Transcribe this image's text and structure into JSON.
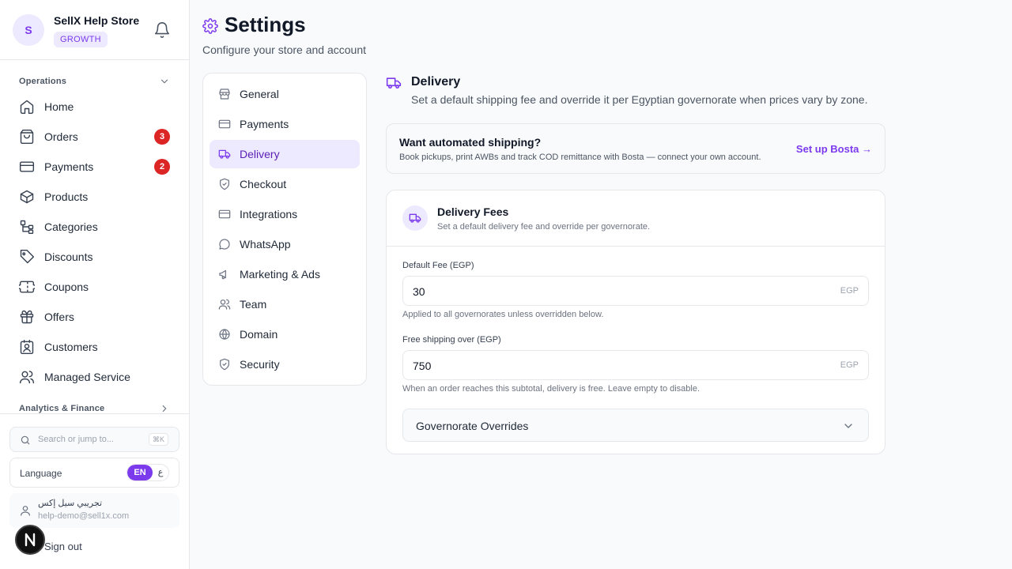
{
  "store": {
    "avatar_letter": "S",
    "name": "SellX Help Store",
    "plan": "GROWTH"
  },
  "sidebar": {
    "operations_title": "Operations",
    "items": [
      {
        "label": "Home",
        "icon": "home-icon"
      },
      {
        "label": "Orders",
        "icon": "shopping-bag-icon",
        "badge": "3"
      },
      {
        "label": "Payments",
        "icon": "credit-card-icon",
        "badge": "2"
      },
      {
        "label": "Products",
        "icon": "box-icon"
      },
      {
        "label": "Categories",
        "icon": "hierarchy-icon"
      },
      {
        "label": "Discounts",
        "icon": "tag-icon"
      },
      {
        "label": "Coupons",
        "icon": "ticket-icon"
      },
      {
        "label": "Offers",
        "icon": "gift-icon"
      },
      {
        "label": "Customers",
        "icon": "contact-icon"
      },
      {
        "label": "Managed Service",
        "icon": "users-icon"
      }
    ],
    "analytics_title": "Analytics & Finance",
    "search_placeholder": "Search or jump to...",
    "search_shortcut": "⌘K",
    "language_label": "Language",
    "lang_en": "EN",
    "lang_ar": "ع",
    "user_name": "تجريبي سيل إكس",
    "user_email": "help-demo@sell1x.com",
    "signout_label": "Sign out"
  },
  "page": {
    "title": "Settings",
    "subtitle": "Configure your store and account"
  },
  "settings_nav": [
    {
      "label": "General",
      "icon": "store-icon"
    },
    {
      "label": "Payments",
      "icon": "credit-card-icon"
    },
    {
      "label": "Delivery",
      "icon": "truck-icon",
      "active": true
    },
    {
      "label": "Checkout",
      "icon": "shield-check-icon"
    },
    {
      "label": "Integrations",
      "icon": "card-icon"
    },
    {
      "label": "WhatsApp",
      "icon": "chat-bubble-icon"
    },
    {
      "label": "Marketing & Ads",
      "icon": "megaphone-icon"
    },
    {
      "label": "Team",
      "icon": "users-icon"
    },
    {
      "label": "Domain",
      "icon": "globe-icon"
    },
    {
      "label": "Security",
      "icon": "shield-icon"
    }
  ],
  "delivery": {
    "title": "Delivery",
    "subtitle": "Set a default shipping fee and override it per Egyptian governorate when prices vary by zone.",
    "bosta": {
      "title": "Want automated shipping?",
      "subtitle": "Book pickups, print AWBs and track COD remittance with Bosta — connect your own account.",
      "link": "Set up Bosta →"
    },
    "fees": {
      "title": "Delivery Fees",
      "subtitle": "Set a default delivery fee and override per governorate.",
      "default_label": "Default Fee (EGP)",
      "default_value": "30",
      "unit": "EGP",
      "default_help": "Applied to all governorates unless overridden below.",
      "free_label": "Free shipping over (EGP)",
      "free_value": "750",
      "free_help": "When an order reaches this subtotal, delivery is free. Leave empty to disable.",
      "overrides_label": "Governorate Overrides"
    }
  },
  "colors": {
    "accent": "#7c3aed",
    "accent_soft": "#ede9fe",
    "badge": "#dc2626"
  }
}
